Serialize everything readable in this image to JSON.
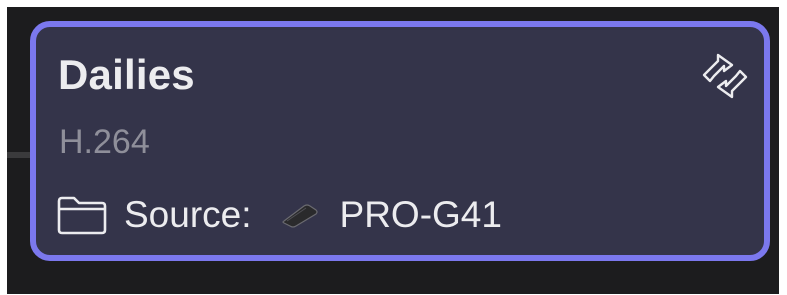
{
  "card": {
    "title": "Dailies",
    "codec": "H.264",
    "source_label": "Source:",
    "source_value": "PRO-G41",
    "border_color": "#7b78ee",
    "background_color": "#34344a"
  },
  "icons": {
    "folder": "folder-icon",
    "drive": "drive-icon",
    "sync": "sync-icon"
  }
}
